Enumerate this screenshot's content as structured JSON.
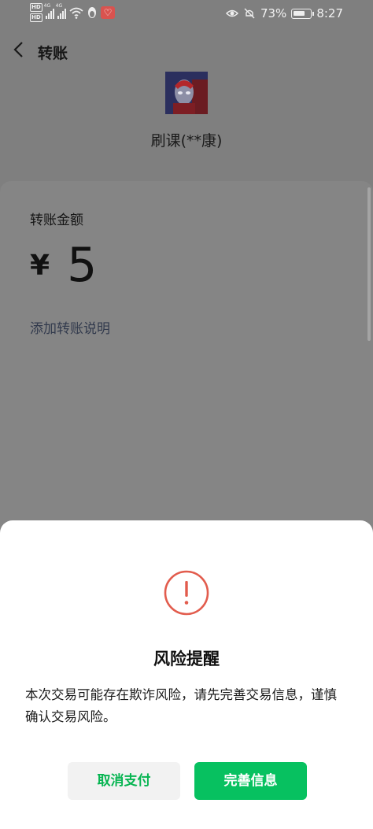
{
  "status_bar": {
    "hd1": "HD",
    "hd2": "HD",
    "net1": "4G",
    "net2": "4G",
    "battery_pct": "73%",
    "time": "8:27",
    "icons": [
      "signal-icon",
      "wifi-icon",
      "penguin-icon",
      "app-badge-icon",
      "eye-icon",
      "mute-icon",
      "battery-icon"
    ]
  },
  "nav": {
    "title": "转账"
  },
  "payee": {
    "name": "刷课(**康)"
  },
  "amount": {
    "label": "转账金额",
    "currency": "¥",
    "value": "5",
    "add_note": "添加转账说明"
  },
  "dialog": {
    "title": "风险提醒",
    "message": "本次交易可能存在欺诈风险，请先完善交易信息，谨慎确认交易风险。",
    "cancel_label": "取消支付",
    "confirm_label": "完善信息",
    "colors": {
      "primary": "#07c160",
      "warning": "#e25c4d",
      "secondary_bg": "#f2f2f2"
    }
  }
}
